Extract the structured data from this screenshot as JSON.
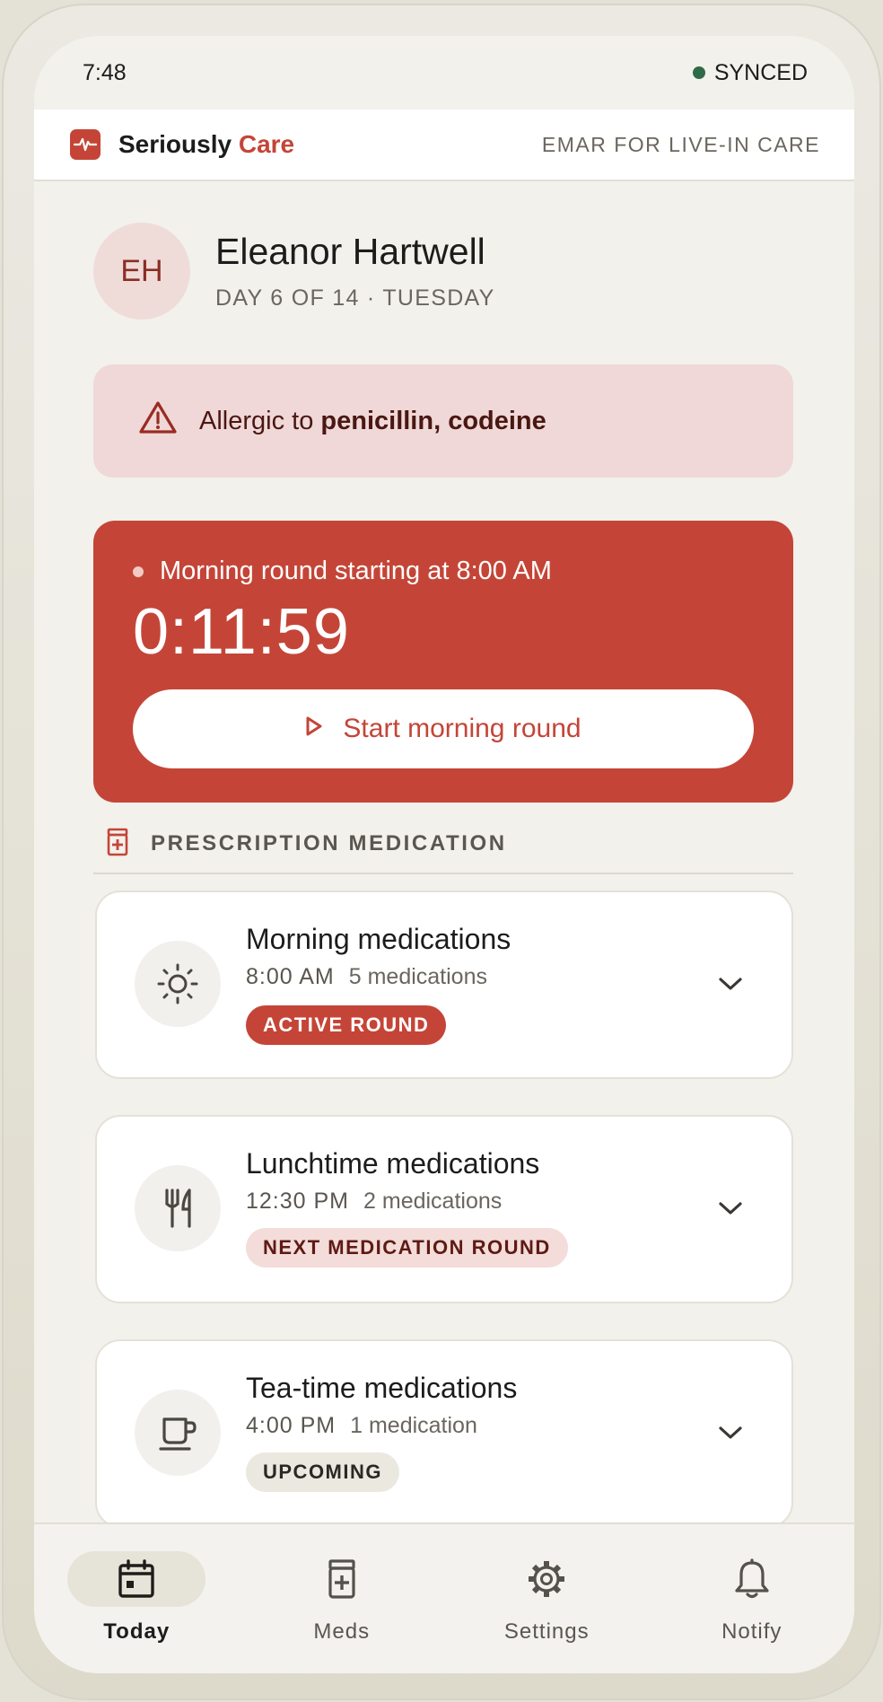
{
  "status": {
    "time": "7:48",
    "sync": "SYNCED"
  },
  "app": {
    "brand_primary": "Seriously",
    "brand_accent": "Care",
    "subtitle": "EMAR FOR LIVE-IN CARE"
  },
  "patient": {
    "initials": "EH",
    "name": "Eleanor Hartwell",
    "meta": "DAY 6 OF 14 · TUESDAY"
  },
  "allergy": {
    "prefix": "Allergic to ",
    "substances": "penicillin, codeine"
  },
  "round": {
    "title": "Morning round starting at 8:00 AM",
    "countdown": "0:11:59",
    "button": "Start morning round"
  },
  "section": {
    "title": "PRESCRIPTION MEDICATION"
  },
  "rounds": [
    {
      "title": "Morning medications",
      "time": "8:00 AM",
      "count": "5 medications",
      "badge": "ACTIVE ROUND",
      "icon": "sun-icon"
    },
    {
      "title": "Lunchtime medications",
      "time": "12:30 PM",
      "count": "2 medications",
      "badge": "NEXT MEDICATION ROUND",
      "icon": "cutlery-icon"
    },
    {
      "title": "Tea-time medications",
      "time": "4:00 PM",
      "count": "1 medication",
      "badge": "UPCOMING",
      "icon": "cup-icon"
    }
  ],
  "nav": [
    {
      "label": "Today",
      "icon": "calendar-icon",
      "active": true
    },
    {
      "label": "Meds",
      "icon": "pill-bottle-icon"
    },
    {
      "label": "Settings",
      "icon": "gear-icon"
    },
    {
      "label": "Notify",
      "icon": "bell-icon"
    }
  ],
  "colors": {
    "accent": "#c44537",
    "synced": "#2f6b46",
    "allergy_bg": "#efd8d7",
    "background": "#f2f1ec"
  }
}
